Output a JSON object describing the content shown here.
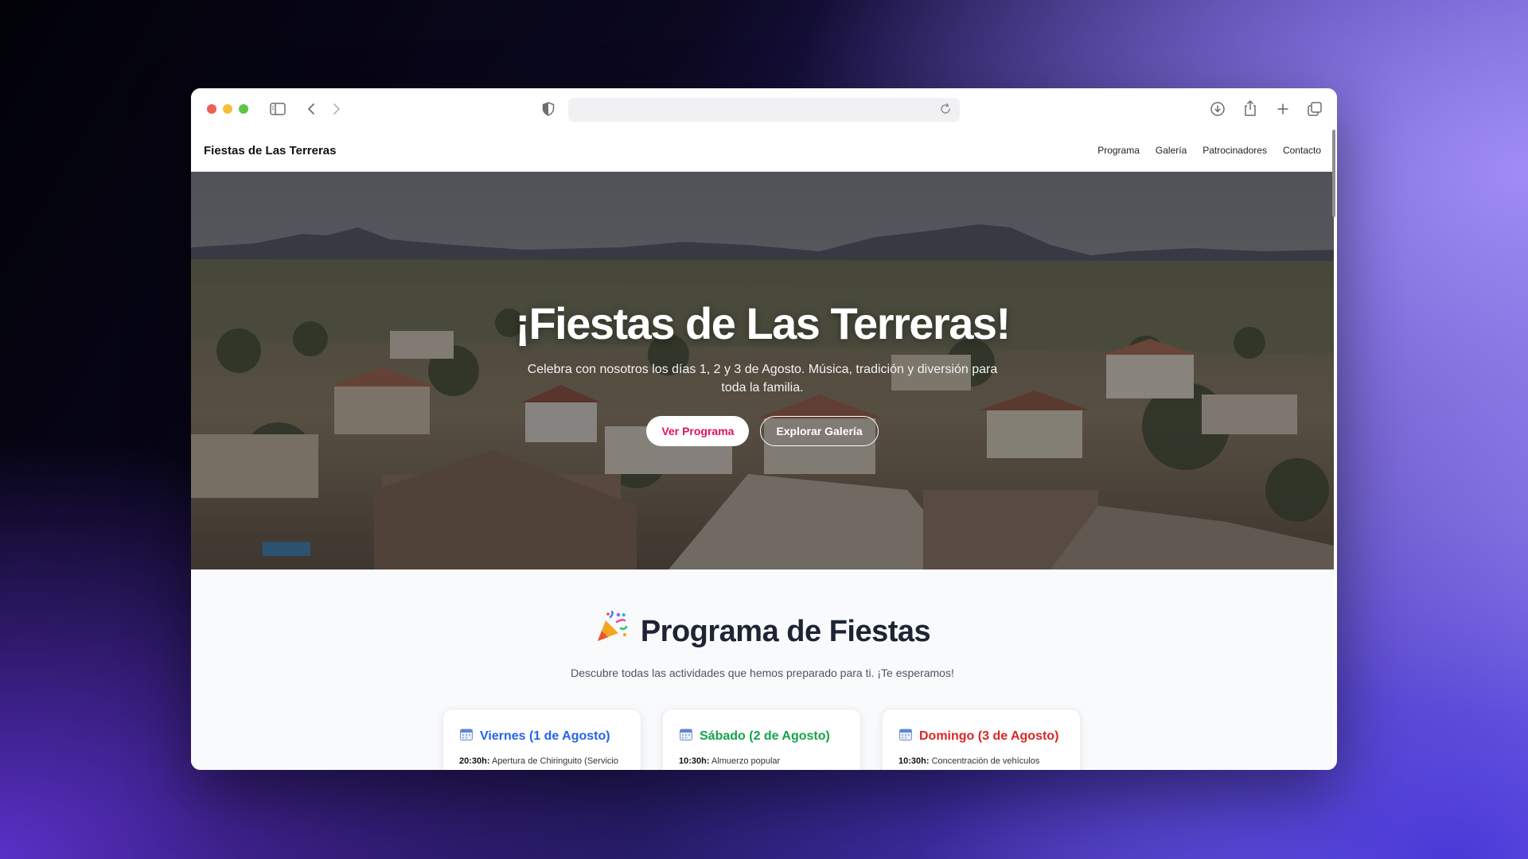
{
  "browser": {
    "url": ""
  },
  "site": {
    "brand": "Fiestas de Las Terreras",
    "nav": [
      "Programa",
      "Galería",
      "Patrocinadores",
      "Contacto"
    ]
  },
  "hero": {
    "title": "¡Fiestas de Las Terreras!",
    "subtitle": "Celebra con nosotros los días 1, 2 y 3 de Agosto. Música, tradición y diversión para toda la familia.",
    "primary_button": "Ver Programa",
    "secondary_button": "Explorar Galería"
  },
  "programa": {
    "title": "Programa de Fiestas",
    "subtitle": "Descubre todas las actividades que hemos preparado para ti. ¡Te esperamos!",
    "days": [
      {
        "title": "Viernes (1 de Agosto)",
        "color": "#2563eb",
        "time": "20:30h:",
        "text": " Apertura de Chiringuito (Servicio de cenas y puesto de bacalaos)"
      },
      {
        "title": "Sábado (2 de Agosto)",
        "color": "#16a34a",
        "time": "10:30h:",
        "text": " Almuerzo popular"
      },
      {
        "title": "Domingo (3 de Agosto)",
        "color": "#dc2626",
        "time": "10:30h:",
        "text": " Concentración de vehículos clásicos"
      }
    ]
  }
}
